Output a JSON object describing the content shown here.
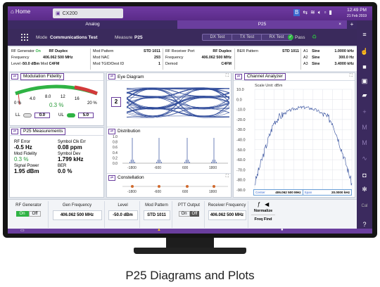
{
  "topbar": {
    "home": "Home",
    "device": "CX200",
    "time": "12:49 PM",
    "date": "21 Feb 2019"
  },
  "mode_tabs": [
    "Analog",
    "P25"
  ],
  "toolbar": {
    "mode_label": "Mode",
    "mode_value": "Communications Test",
    "measure_label": "Measure",
    "measure_value": "P25",
    "tests": [
      "DX Test",
      "TX Test",
      "RX Test"
    ],
    "pass_label": "Pass"
  },
  "info": {
    "rf_generator": {
      "label": "RF Generator",
      "state": "On",
      "duplex": "RF Duplex",
      "freq_label": "Frequency",
      "freq": "406.062 500 MHz",
      "level_label": "Level",
      "level": "-50.0 dBm",
      "mod_label": "Mod",
      "mod": "C4FM"
    },
    "mod_pattern": {
      "label": "Mod Pattern",
      "value": "STD 1011",
      "nac_label": "Mod NAC",
      "nac": "293",
      "tgid_label": "Mod TGID/Dest ID",
      "tgid": "1"
    },
    "receiver": {
      "port_label": "RF Receiver Port",
      "port": "RF Duplex",
      "freq_label": "Frequency",
      "freq": "406.062 500 MHz",
      "demod_label": "Demod",
      "demod": "C4FM"
    },
    "ber": {
      "label": "BER Pattern",
      "value": "STD 1011"
    },
    "audio": [
      {
        "ch": "A1",
        "wave": "Sine",
        "freq": "1.0000 kHz"
      },
      {
        "ch": "A2",
        "wave": "Sine",
        "freq": "300.0 Hz"
      },
      {
        "ch": "A3",
        "wave": "Sine",
        "freq": "3.4000 kHz"
      }
    ]
  },
  "mod_fidelity": {
    "title": "Modulation Fidelity",
    "ticks": [
      "0 %",
      "4.0",
      "8.0",
      "12",
      "16",
      "20 %"
    ],
    "value": "0.3 %",
    "ll_label": "LL",
    "ll_value": "0.0",
    "ul_label": "UL",
    "ul_value": "5.0"
  },
  "p25": {
    "title": "P25 Measurements",
    "items": [
      {
        "label": "RF Error",
        "value": "-0.5 Hz"
      },
      {
        "label": "Symbol Clk Err",
        "value": "0.08 ppm"
      },
      {
        "label": "Mod Fidelity",
        "value": "0.3 %"
      },
      {
        "label": "Symbol Dev",
        "value": "1.799 kHz"
      },
      {
        "label": "Signal Power",
        "value": "1.95 dBm"
      },
      {
        "label": "BER",
        "value": "0.0 %"
      }
    ]
  },
  "eye": {
    "title": "Eye Diagram",
    "symbols": "2"
  },
  "distribution": {
    "title": "Distribution",
    "y_ticks": [
      "1.0",
      "0.8",
      "0.6",
      "0.4",
      "0.2",
      "0.0"
    ],
    "x_ticks": [
      "-1800",
      "-600",
      "600",
      "1800"
    ]
  },
  "constellation": {
    "title": "Constellation",
    "x_ticks": [
      "-1800",
      "-600",
      "600",
      "1800"
    ]
  },
  "analyzer": {
    "title": "Channel Analyzer",
    "scale": "Scale Unit: dBm",
    "y_ticks": [
      "10.0",
      "0.0",
      "-10.0",
      "-20.0",
      "-30.0",
      "-40.0",
      "-50.0",
      "-60.0",
      "-70.0",
      "-80.0",
      "-90.0"
    ],
    "center_label": "Center",
    "center": "406.062 500 MHz",
    "span_label": "Span",
    "span": "20.0000 kHz"
  },
  "bottom": {
    "rf_gen": {
      "label": "RF Generator",
      "on": "On",
      "off": "Off"
    },
    "gen_freq": {
      "label": "Gen Frequency",
      "value": "406.062 500 MHz"
    },
    "level": {
      "label": "Level",
      "value": "-50.0 dBm"
    },
    "mod_pattern": {
      "label": "Mod Pattern",
      "value": "STD 1011"
    },
    "ptt": {
      "label": "PTT Output",
      "on": "On",
      "off": "Off"
    },
    "rx_freq": {
      "label": "Receiver Frequency",
      "value": "406.062 500 MHz"
    },
    "normalize": "Normalize",
    "freq_find": "Freq Find"
  },
  "caption": "P25 Diagrams and Plots",
  "colors": {
    "accent": "#6a3e9e",
    "trace": "#2e4a9a",
    "pass": "#2fb344",
    "value_green": "#2a9a3a"
  }
}
